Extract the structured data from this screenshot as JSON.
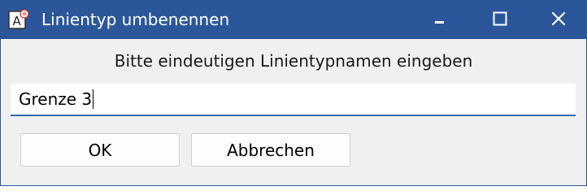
{
  "window": {
    "title": "Linientyp umbenennen",
    "titlebar_color": "#2b579a",
    "controls": {
      "minimize_icon": "minimize-icon",
      "maximize_icon": "maximize-icon",
      "close_icon": "close-icon"
    }
  },
  "dialog": {
    "prompt": "Bitte eindeutigen Linientypnamen eingeben",
    "input_value": "Grenze 3",
    "ok_label": "OK",
    "cancel_label": "Abbrechen"
  }
}
